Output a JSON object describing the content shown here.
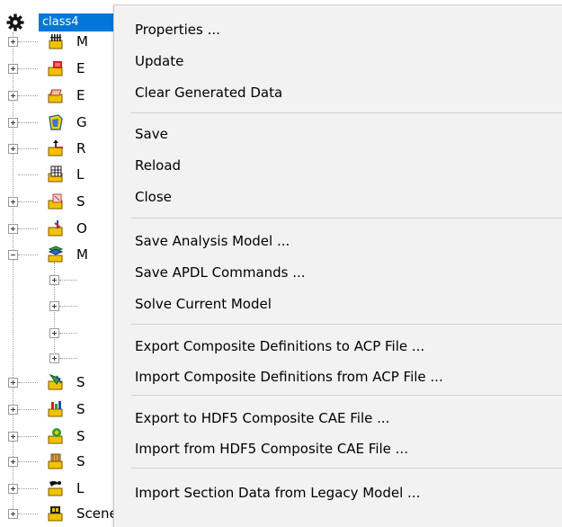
{
  "tree": {
    "root": {
      "label": "class4",
      "icon": "gear-icon"
    },
    "nodes": [
      {
        "letter": "M",
        "icon": "material-data-icon",
        "expander": "plus"
      },
      {
        "letter": "E",
        "icon": "element-sets-icon",
        "expander": "plus"
      },
      {
        "letter": "E",
        "icon": "edge-sets-icon",
        "expander": "plus"
      },
      {
        "letter": "G",
        "icon": "geometry-icon",
        "expander": "plus"
      },
      {
        "letter": "R",
        "icon": "rosettes-icon",
        "expander": "plus"
      },
      {
        "letter": "L",
        "icon": "lookup-table-icon",
        "expander": "none"
      },
      {
        "letter": "S",
        "icon": "selection-rules-icon",
        "expander": "plus"
      },
      {
        "letter": "O",
        "icon": "oriented-sets-icon",
        "expander": "plus"
      },
      {
        "letter": "M",
        "icon": "modeling-groups-icon",
        "expander": "minus"
      },
      {
        "letter": "",
        "icon": "",
        "expander": "plus",
        "child": true
      },
      {
        "letter": "",
        "icon": "",
        "expander": "plus",
        "child": true
      },
      {
        "letter": "",
        "icon": "",
        "expander": "plus",
        "child": true
      },
      {
        "letter": "",
        "icon": "",
        "expander": "plus",
        "child": true
      },
      {
        "letter": "S",
        "icon": "sampling-points-icon",
        "expander": "plus"
      },
      {
        "letter": "S",
        "icon": "section-cuts-icon",
        "expander": "plus"
      },
      {
        "letter": "S",
        "icon": "sensors-icon",
        "expander": "plus"
      },
      {
        "letter": "S",
        "icon": "solid-models-icon",
        "expander": "plus"
      },
      {
        "letter": "L",
        "icon": "layup-plots-icon",
        "expander": "plus"
      },
      {
        "letter": "Scenes",
        "icon": "scenes-icon",
        "expander": "plus"
      }
    ]
  },
  "menu": {
    "groups": [
      [
        "Properties ...",
        "Update",
        "Clear Generated Data"
      ],
      [
        "Save",
        "Reload",
        "Close"
      ],
      [
        "Save Analysis Model ...",
        "Save APDL Commands ...",
        "Solve Current Model"
      ],
      [
        "Export Composite Definitions to ACP File ...",
        "Import Composite Definitions from ACP File ..."
      ],
      [
        "Export to HDF5 Composite CAE File ...",
        "Import from HDF5 Composite CAE File ..."
      ],
      [
        "Import Section Data from Legacy Model ..."
      ]
    ]
  },
  "colors": {
    "selection": "#0078d7",
    "menu_background": "#f2f2f2",
    "separator": "#d0d0d0"
  }
}
